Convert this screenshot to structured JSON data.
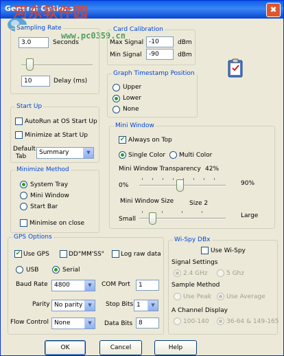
{
  "window": {
    "title": "General Options",
    "close": "✖",
    "watermark": "河东软件园",
    "watermark_url": "www.pc0359.cn"
  },
  "sampling": {
    "legend": "Sampling Rate",
    "rate_value": "3.0",
    "rate_unit": "Seconds",
    "slider_level": 0.08,
    "delay_value": "10",
    "delay_unit": "Delay (ms)"
  },
  "card_calibration": {
    "legend": "Card Calibration",
    "max_label": "Max Signal",
    "max_value": "-10",
    "max_unit": "dBm",
    "min_label": "Min Signal",
    "min_value": "-90",
    "min_unit": "dBm"
  },
  "timestamp": {
    "legend": "Graph Timestamp Position",
    "options": [
      "Upper",
      "Lower",
      "None"
    ],
    "selected": "Lower"
  },
  "startup": {
    "legend": "Start Up",
    "autorun_label": "AutoRun at OS Start Up",
    "autorun_checked": false,
    "minimize_label": "Minimize at Start Up",
    "minimize_checked": false,
    "default_tab_label_1": "Default",
    "default_tab_label_2": "Tab",
    "default_tab_value": "Summary"
  },
  "minimize_method": {
    "legend": "Minimize Method",
    "options": [
      "System Tray",
      "Mini Window",
      "Start Bar"
    ],
    "selected": "System Tray",
    "on_close_label": "Minimise on close",
    "on_close_checked": false
  },
  "mini_window": {
    "legend": "Mini Window",
    "always_on_top_label": "Always on Top",
    "always_on_top_checked": true,
    "single_color_label": "Single Color",
    "multi_color_label": "Multi Color",
    "color_selected": "Single Color",
    "transparency_label": "Mini Window Transparency",
    "transparency_value": "42%",
    "transparency_min": "0%",
    "transparency_max": "90%",
    "transparency_level": 0.47,
    "size_label": "Mini Window Size",
    "size_value": "Size 2",
    "size_min": "Small",
    "size_max": "Large",
    "size_level": 0.12
  },
  "gps": {
    "legend": "GPS Options",
    "use_gps_label": "Use GPS",
    "use_gps_checked": true,
    "dd_label": "DD°MM'SS\"",
    "dd_checked": false,
    "raw_label": "Log raw data",
    "raw_checked": false,
    "usb_label": "USB",
    "serial_label": "Serial",
    "port_type_selected": "Serial",
    "baud_label": "Baud Rate",
    "baud_value": "4800",
    "com_label": "COM Port",
    "com_value": "1",
    "parity_label": "Parity",
    "parity_value": "No parity",
    "stop_label": "Stop Bits",
    "stop_value": "1",
    "flow_label": "Flow Control",
    "flow_value": "None",
    "data_label": "Data Bits",
    "data_value": "8"
  },
  "wispy": {
    "legend": "Wi-Spy DBx",
    "use_label": "Use Wi-Spy",
    "use_checked": false,
    "signal_label": "Signal  Settings",
    "signal_options": [
      "2.4 GHz",
      "5 Ghz"
    ],
    "signal_selected": "2.4 GHz",
    "sample_label": "Sample Method",
    "sample_options": [
      "Use Peak",
      "Use Average"
    ],
    "sample_selected": "Use Average",
    "channel_label": "A Channel Display",
    "channel_options": [
      "100-140",
      "36-64 & 149-165"
    ],
    "channel_selected": "36-64 & 149-165"
  },
  "buttons": {
    "ok": "OK",
    "cancel": "Cancel",
    "help": "Help"
  },
  "colors": {
    "legend": "#0046d5",
    "check": "#21a121",
    "titlebar": "#0a5fe3"
  },
  "icons": {
    "clipboard": "clipboard-icon",
    "close": "close-icon"
  }
}
